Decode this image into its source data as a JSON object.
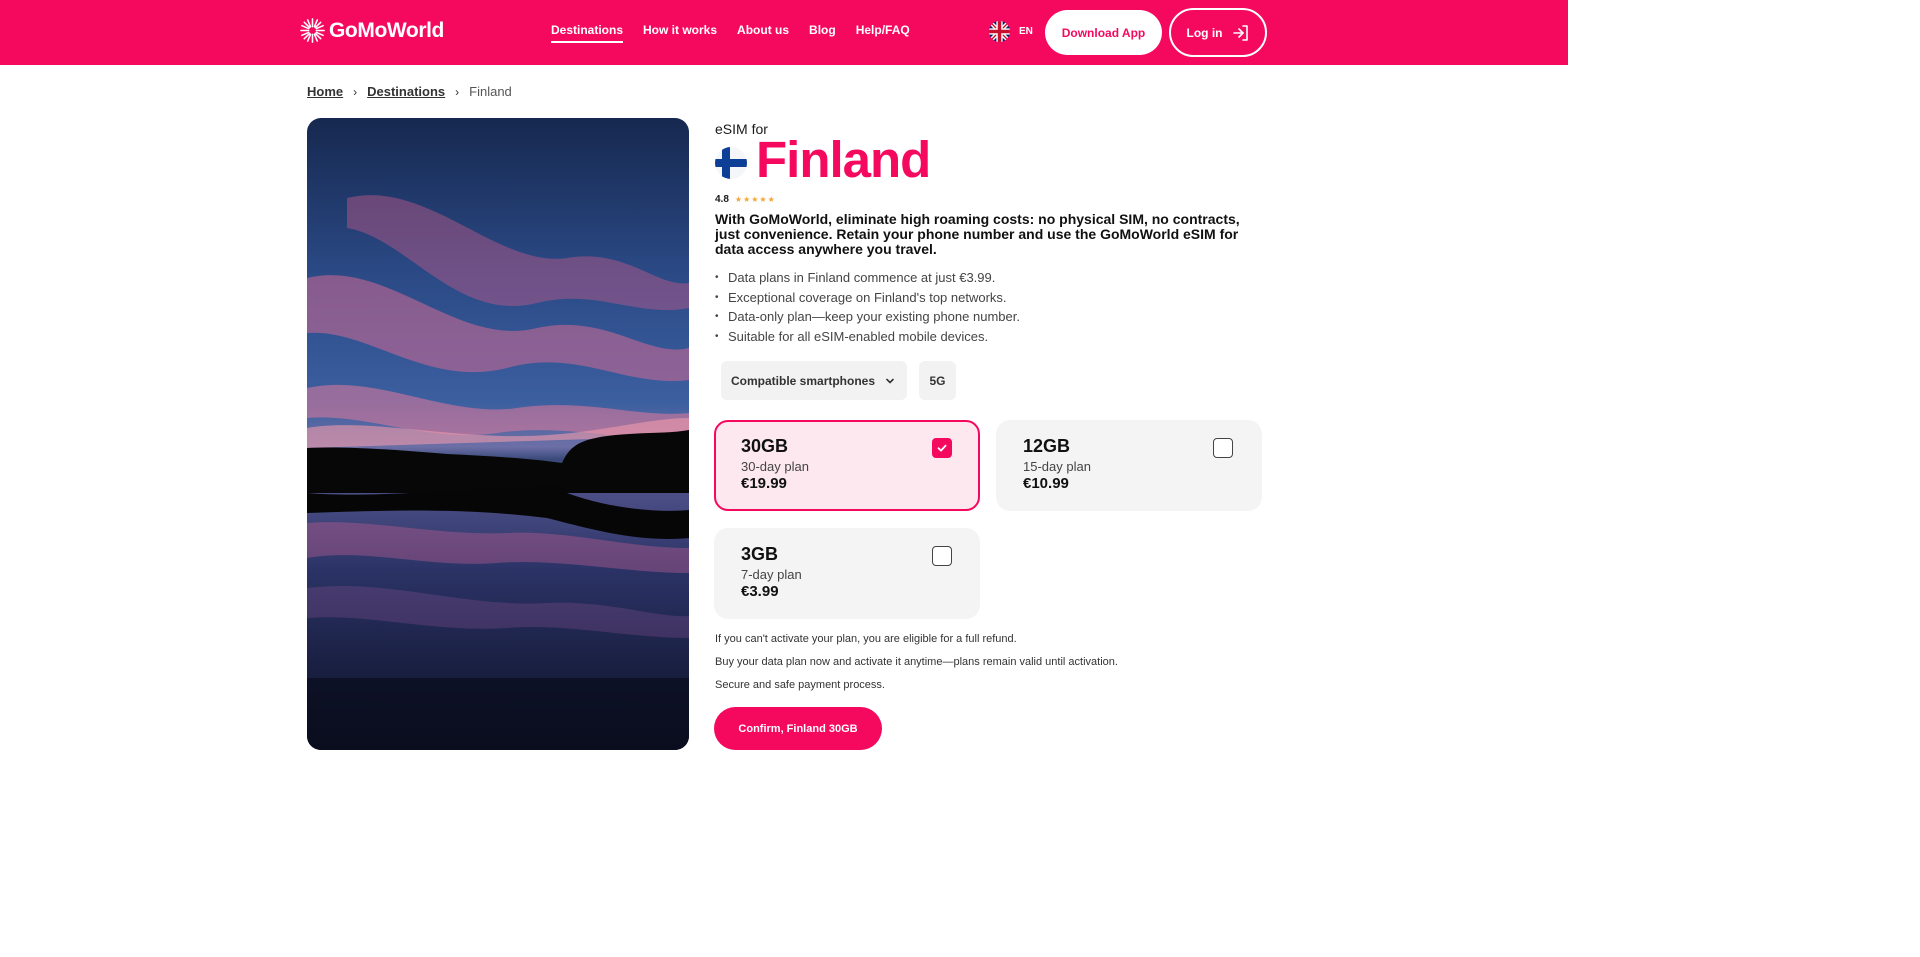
{
  "header": {
    "brand": "GoMoWorld",
    "nav": [
      "Destinations",
      "How it works",
      "About us",
      "Blog",
      "Help/FAQ"
    ],
    "language": "EN",
    "download_label": "Download App",
    "login_label": "Log in",
    "accent_color": "#f5095f"
  },
  "breadcrumb": {
    "home": "Home",
    "destinations": "Destinations",
    "current": "Finland"
  },
  "product": {
    "eyebrow": "eSIM for",
    "country": "Finland",
    "rating": "4.8",
    "rating_stars": 4.8,
    "lead": "With GoMoWorld, eliminate high roaming costs: no physical SIM, no contracts, just convenience. Retain your phone number and use the GoMoWorld eSIM for data access anywhere you travel.",
    "bullets": [
      "Data plans in Finland commence at just €3.99.",
      "Exceptional coverage on Finland's top networks.",
      "Data-only plan—keep your existing phone number.",
      "Suitable for all eSIM-enabled mobile devices."
    ],
    "compatible_label": "Compatible smartphones",
    "network_badge": "5G"
  },
  "plans": [
    {
      "data": "30GB",
      "period": "30-day plan",
      "price": "€19.99",
      "selected": true
    },
    {
      "data": "12GB",
      "period": "15-day plan",
      "price": "€10.99",
      "selected": false
    },
    {
      "data": "3GB",
      "period": "7-day plan",
      "price": "€3.99",
      "selected": false
    }
  ],
  "notes": [
    "If you can't activate your plan, you are eligible for a full refund.",
    "Buy your data plan now and activate it anytime—plans remain valid until activation.",
    "Secure and safe payment process."
  ],
  "confirm_label": "Confirm, Finland 30GB"
}
